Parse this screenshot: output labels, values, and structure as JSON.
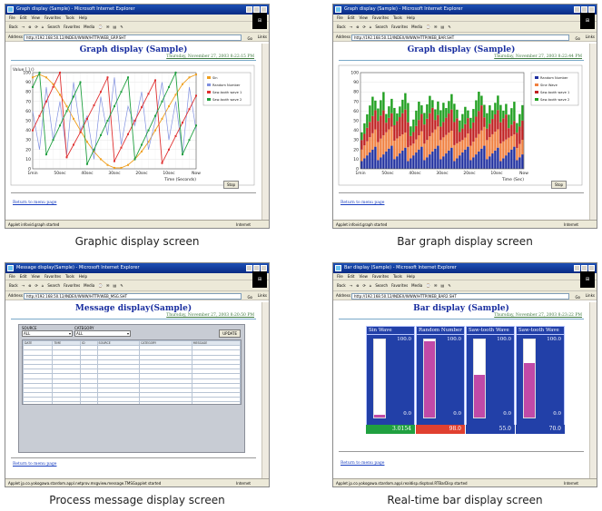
{
  "browser": {
    "menu": [
      "File",
      "Edit",
      "View",
      "Favorites",
      "Tools",
      "Help"
    ],
    "toolbar": [
      "Back",
      "→",
      "⊗",
      "⟳",
      "⌂",
      "Search",
      "Favorites",
      "Media",
      "⌚",
      "✉",
      "▤",
      "✎"
    ],
    "address_label": "Address",
    "go_label": "Go",
    "links_label": "Links",
    "zone_label": "Internet",
    "return_link": "Return to menu page",
    "date_text": "Thursday, November 27, 2003 8:22:15 PM"
  },
  "panels": [
    {
      "caption": "Graphic display screen",
      "window_title": "Graph display (Sample) - Microsoft Internet Explorer",
      "address": "http://192.168.50.12/INDEX/WWW/HTTP/WEB_GRP.SHT",
      "page_title": "Graph display (Sample)",
      "date": "Thursday, November 27, 2003 8:22:15 PM",
      "status": "Applet infovid.graph started",
      "stop_label": "Stop"
    },
    {
      "caption": "Bar graph display screen",
      "window_title": "Graph display (Sample) - Microsoft Internet Explorer",
      "address": "http://192.168.50.12/INDEX/WWW/HTTP/WEB_BAR.SHT",
      "page_title": "Graph display (Sample)",
      "date": "Thursday, November 27, 2003 8:22:44 PM",
      "status": "Applet infovid.graph started",
      "stop_label": "Stop"
    },
    {
      "caption": "Process message display screen",
      "window_title": "Message display(Sample) - Microsoft Internet Explorer",
      "address": "http://192.168.50.12/INDEX/WWW/HTTP/WEB_MSG.SHT",
      "page_title": "Message display(Sample)",
      "date": "Thursday, November 27, 2003 8:20:50 PM",
      "status": "Applet jp.co.yokogawa.stardom.appl.netprov.msgview.message.TMSGapplet started",
      "source_label": "SOURCE",
      "source_value": "ALL",
      "category_label": "CATEGORY",
      "category_value": "ALL",
      "update_label": "UPDATE",
      "columns": [
        "DATE",
        "TIME",
        "ID",
        "SOURCE",
        "CATEGORY",
        "MESSAGE"
      ]
    },
    {
      "caption": "Real-time bar display screen",
      "window_title": "Bar display (Sample) - Microsoft Internet Explorer",
      "address": "http://192.168.50.12/INDEX/WWW/HTTP/WEB_BAR2.SHT",
      "page_title": "Bar display (Sample)",
      "date": "Thursday, November 27, 2003 8:23:22 PM",
      "status": "Applet jp.co.yokogawa.stardom.appl.realdisp.disptool.RTBarDisp started"
    }
  ],
  "chart_data": [
    {
      "type": "line",
      "ylabel": "Value [ ] ()",
      "xlabel": "Time (Seconds)",
      "ylim": [
        0,
        100
      ],
      "yticks": [
        0,
        10,
        20,
        30,
        40,
        50,
        60,
        70,
        80,
        90,
        100
      ],
      "xticks": [
        "1min",
        "50sec",
        "40sec",
        "30sec",
        "20sec",
        "10sec",
        "Now"
      ],
      "series": [
        {
          "name": "Sin",
          "color": "#f0a020",
          "values": [
            95,
            98,
            95,
            88,
            77,
            65,
            52,
            40,
            28,
            18,
            10,
            4,
            1,
            1,
            4,
            10,
            18,
            28,
            40,
            52,
            65,
            77,
            88,
            95,
            98
          ]
        },
        {
          "name": "Random Number",
          "color": "#8090e0",
          "values": [
            60,
            20,
            85,
            30,
            70,
            15,
            90,
            40,
            55,
            10,
            75,
            35,
            95,
            25,
            65,
            45,
            80,
            20,
            50,
            90,
            30,
            70,
            15,
            85,
            40
          ]
        },
        {
          "name": "Saw-tooth wave 1",
          "color": "#e03030",
          "values": [
            40,
            55,
            70,
            85,
            100,
            12,
            25,
            38,
            52,
            66,
            80,
            95,
            8,
            22,
            36,
            50,
            64,
            78,
            92,
            6,
            20,
            34,
            48,
            62,
            76
          ]
        },
        {
          "name": "Saw-tooth wave 2",
          "color": "#20a040",
          "values": [
            85,
            100,
            15,
            30,
            45,
            60,
            75,
            90,
            5,
            20,
            35,
            50,
            65,
            80,
            95,
            10,
            25,
            40,
            55,
            70,
            85,
            100,
            15,
            30,
            45
          ]
        }
      ]
    },
    {
      "type": "bar",
      "ylim": [
        0,
        100
      ],
      "yticks": [
        0,
        10,
        20,
        30,
        40,
        50,
        60,
        70,
        80,
        90,
        100
      ],
      "xticks": [
        "1min",
        "50sec",
        "40sec",
        "30sec",
        "20sec",
        "10sec",
        "Now"
      ],
      "xlabel": "Time (Sec)",
      "series": [
        {
          "name": "Random Number",
          "color": "#2030a0"
        },
        {
          "name": "Sine Wave",
          "color": "#f08040"
        },
        {
          "name": "Saw-tooth wave 1",
          "color": "#c02020"
        },
        {
          "name": "Saw-tooth wave 2",
          "color": "#20a020"
        }
      ]
    },
    {
      "type": "bar",
      "series": [
        {
          "name": "Sin Wave",
          "max": "100.0",
          "min": "0.0",
          "value": 3.0154,
          "display": "3.0154",
          "value_bg": "#20a040"
        },
        {
          "name": "Random Number",
          "max": "100.0",
          "min": "0.0",
          "value": 98.0,
          "display": "98.0",
          "value_bg": "#e04030"
        },
        {
          "name": "Saw-tooth Wave",
          "max": "100.0",
          "min": "0.0",
          "value": 55.0,
          "display": "55.0",
          "value_bg": "#2240a8"
        },
        {
          "name": "Saw-tooth Wave",
          "max": "100.0",
          "min": "0.0",
          "value": 70.0,
          "display": "70.0",
          "value_bg": "#2240a8"
        }
      ]
    }
  ]
}
